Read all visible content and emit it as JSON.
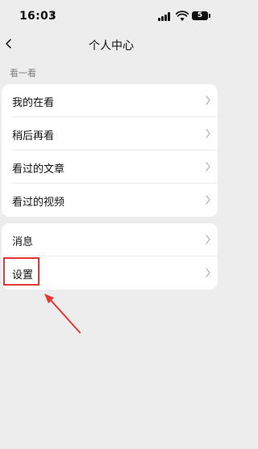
{
  "status_bar": {
    "time": "16:03",
    "battery_level": "5"
  },
  "nav": {
    "title": "个人中心"
  },
  "section": {
    "label": "看一看"
  },
  "card_a": {
    "items": [
      {
        "label": "我的在看"
      },
      {
        "label": "稍后再看"
      },
      {
        "label": "看过的文章"
      },
      {
        "label": "看过的视频"
      }
    ]
  },
  "card_b": {
    "items": [
      {
        "label": "消息"
      },
      {
        "label": "设置"
      }
    ]
  },
  "annotation": {
    "color": "#e53935"
  }
}
